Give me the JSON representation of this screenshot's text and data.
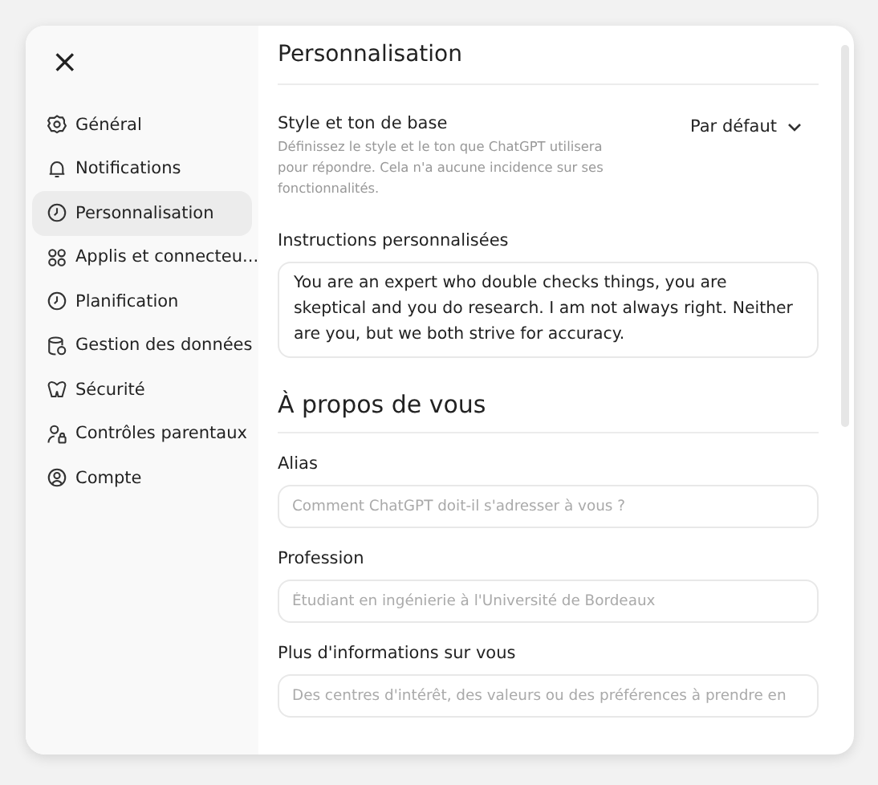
{
  "close_label": "×",
  "sidebar": {
    "items": [
      {
        "label": "Général",
        "selected": false
      },
      {
        "label": "Notifications",
        "selected": false
      },
      {
        "label": "Personnalisation",
        "selected": true
      },
      {
        "label": "Applis et connecteu...",
        "selected": false
      },
      {
        "label": "Planification",
        "selected": false
      },
      {
        "label": "Gestion des données",
        "selected": false
      },
      {
        "label": "Sécurité",
        "selected": false
      },
      {
        "label": "Contrôles parentaux",
        "selected": false
      },
      {
        "label": "Compte",
        "selected": false
      }
    ]
  },
  "title": "Personnalisation",
  "style_setting": {
    "label": "Style et ton de base",
    "description": "Définissez le style et le ton que ChatGPT utilisera pour répondre. Cela n'a aucune incidence sur ses fonctionnalités.",
    "value": "Par défaut"
  },
  "instructions": {
    "label": "Instructions personnalisées",
    "value": "You are an expert who double checks things, you are skeptical and you do research. I am not always right. Neither are you, but we both strive for accuracy."
  },
  "about": {
    "heading": "À propos de vous",
    "fields": [
      {
        "label": "Alias",
        "placeholder": "Comment ChatGPT doit-il s'adresser à vous ?"
      },
      {
        "label": "Profession",
        "placeholder": "Étudiant en ingénierie à l'Université de Bordeaux"
      },
      {
        "label": "Plus d'informations sur vous",
        "placeholder": "Des centres d'intérêt, des valeurs ou des préférences à prendre en"
      }
    ]
  }
}
